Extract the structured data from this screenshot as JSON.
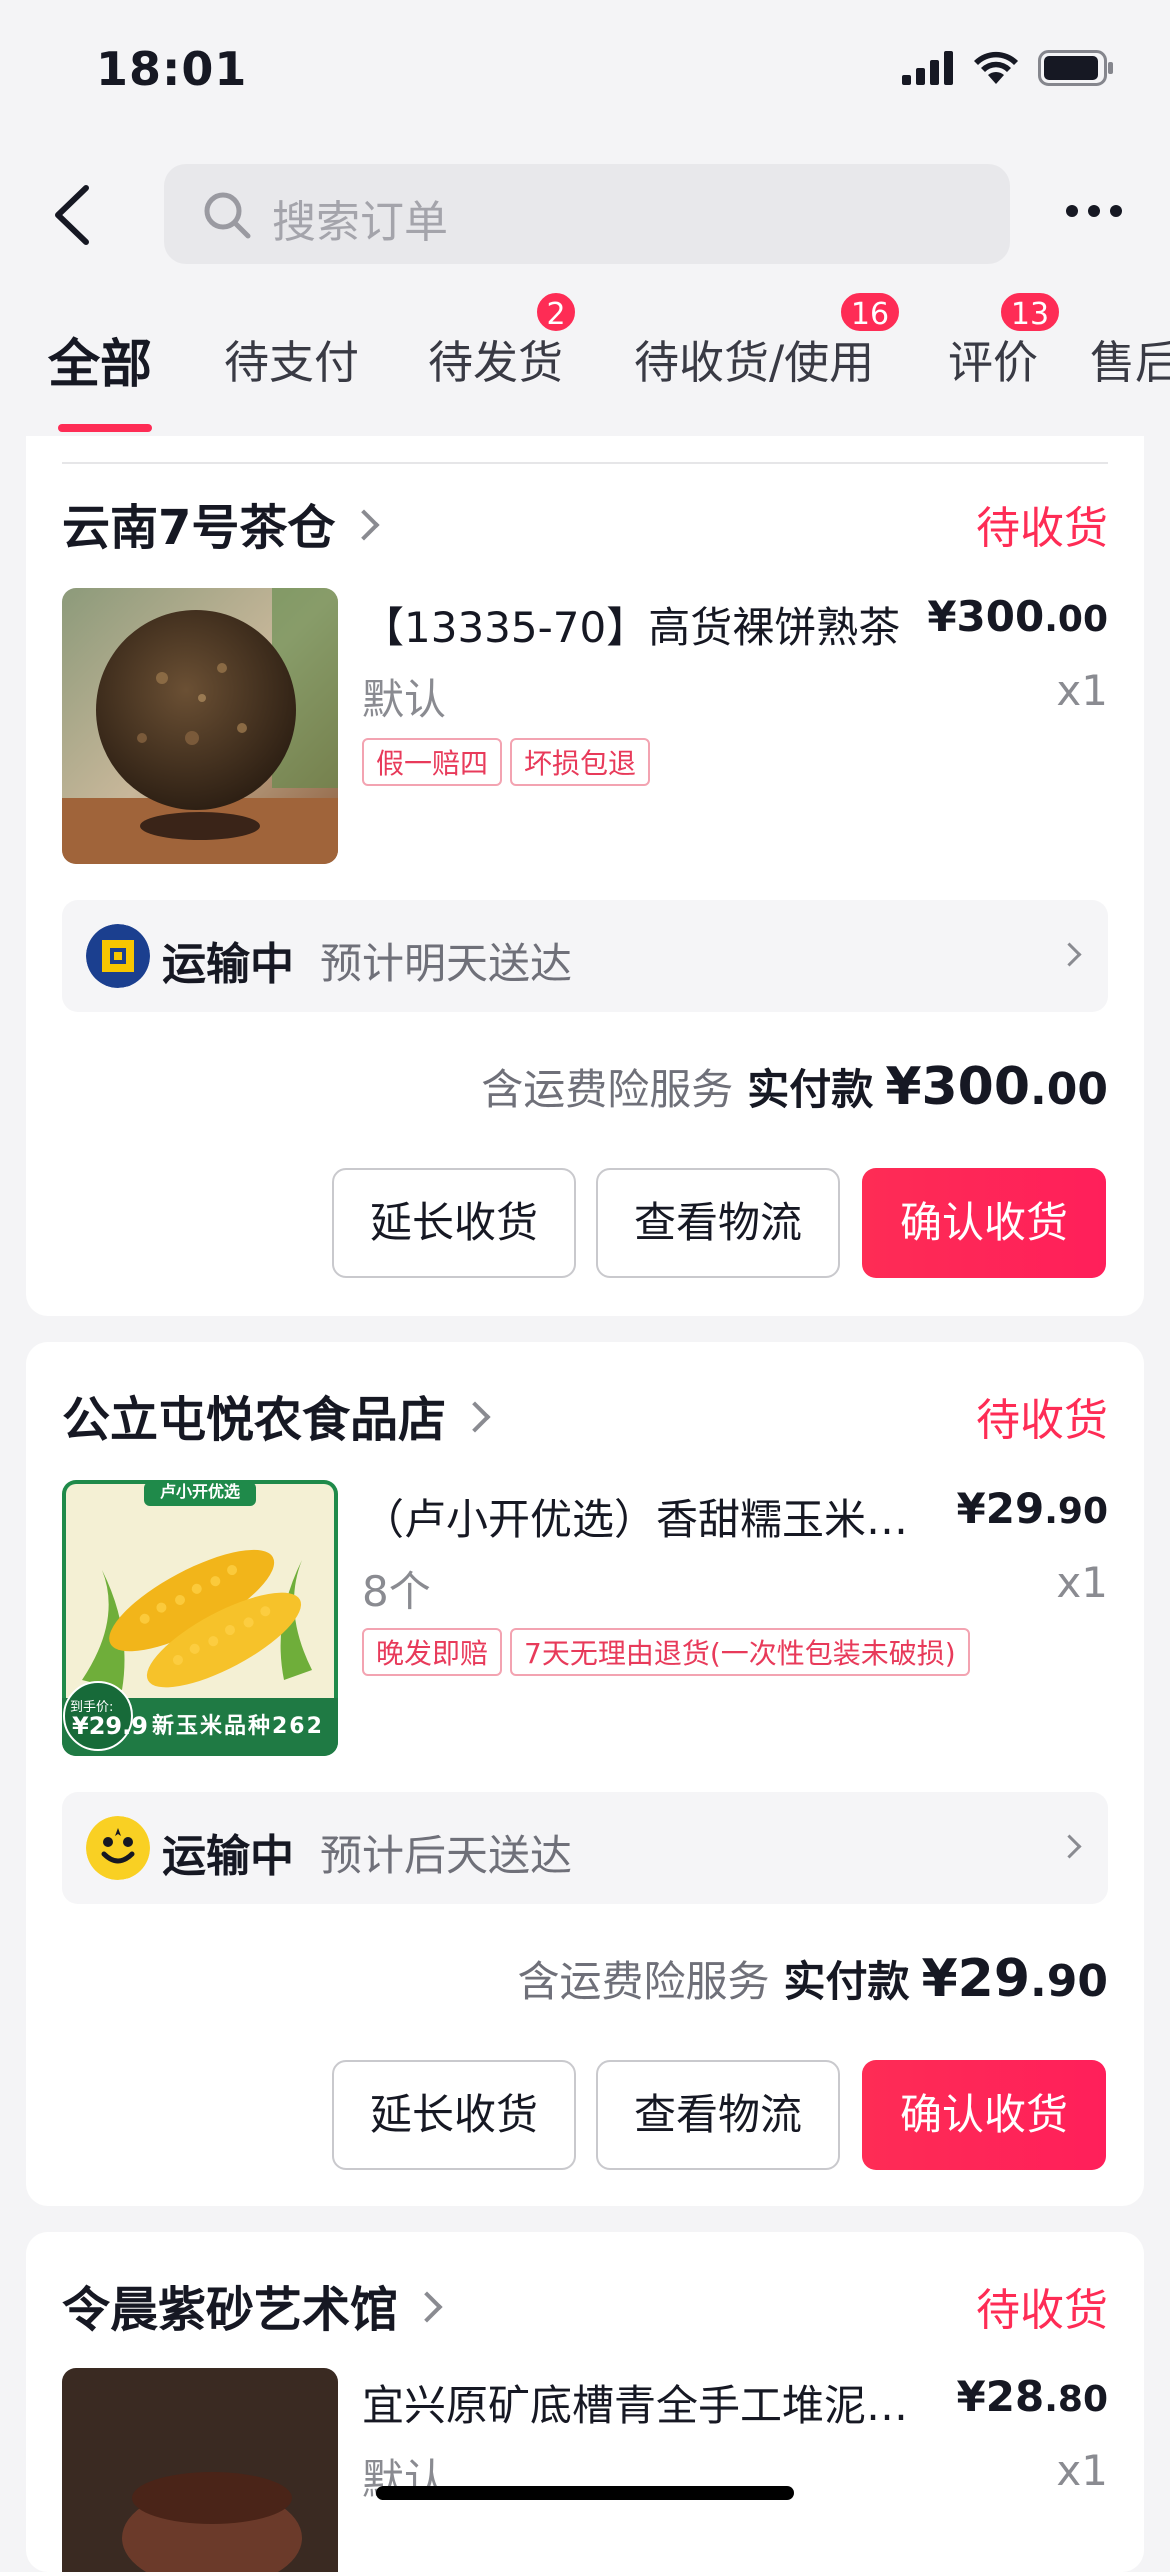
{
  "status_bar": {
    "time": "18:01"
  },
  "search": {
    "placeholder": "搜索订单"
  },
  "tabs": [
    {
      "label": "全部",
      "active": true
    },
    {
      "label": "待支付"
    },
    {
      "label": "待发货",
      "badge": "2"
    },
    {
      "label": "待收货/使用",
      "badge": "16"
    },
    {
      "label": "评价",
      "badge": "13"
    },
    {
      "label": "售后"
    }
  ],
  "colors": {
    "accent": "#fe2c55",
    "background": "#f4f4f6"
  },
  "orders": [
    {
      "shop": "云南7号茶仓",
      "status": "待收货",
      "product_title": "【13335-70】高货裸饼熟茶",
      "price_int": "¥300",
      "price_dec": ".00",
      "spec": "默认",
      "qty": "x1",
      "tags": [
        "假一赔四",
        "坏损包退"
      ],
      "logistics_status": "运输中",
      "logistics_eta": "预计明天送达",
      "service": "含运费险服务",
      "paid_label": "实付款",
      "paid_int": "¥300",
      "paid_dec": ".00",
      "buttons": [
        "延长收货",
        "查看物流",
        "确认收货"
      ]
    },
    {
      "shop": "公立屯悦农食品店",
      "status": "待收货",
      "product_title": "（卢小开优选）香甜糯玉米新鲜",
      "price_int": "¥29",
      "price_dec": ".90",
      "spec": "8个",
      "qty": "x1",
      "tags": [
        "晚发即赔",
        "7天无理由退货(一次性包装未破损)"
      ],
      "thumb_banner": "卢小开优选",
      "thumb_footer": "新玉米品种262",
      "thumb_price_label": "到手价:",
      "thumb_price": "¥29.9",
      "logistics_status": "运输中",
      "logistics_eta": "预计后天送达",
      "service": "含运费险服务",
      "paid_label": "实付款",
      "paid_int": "¥29",
      "paid_dec": ".90",
      "buttons": [
        "延长收货",
        "查看物流",
        "确认收货"
      ]
    },
    {
      "shop": "令晨紫砂艺术馆",
      "status": "待收货",
      "product_title": "宜兴原矿底槽青全手工堆泥茶杯",
      "price_int": "¥28",
      "price_dec": ".80",
      "spec": "默认",
      "qty": "x1"
    }
  ]
}
